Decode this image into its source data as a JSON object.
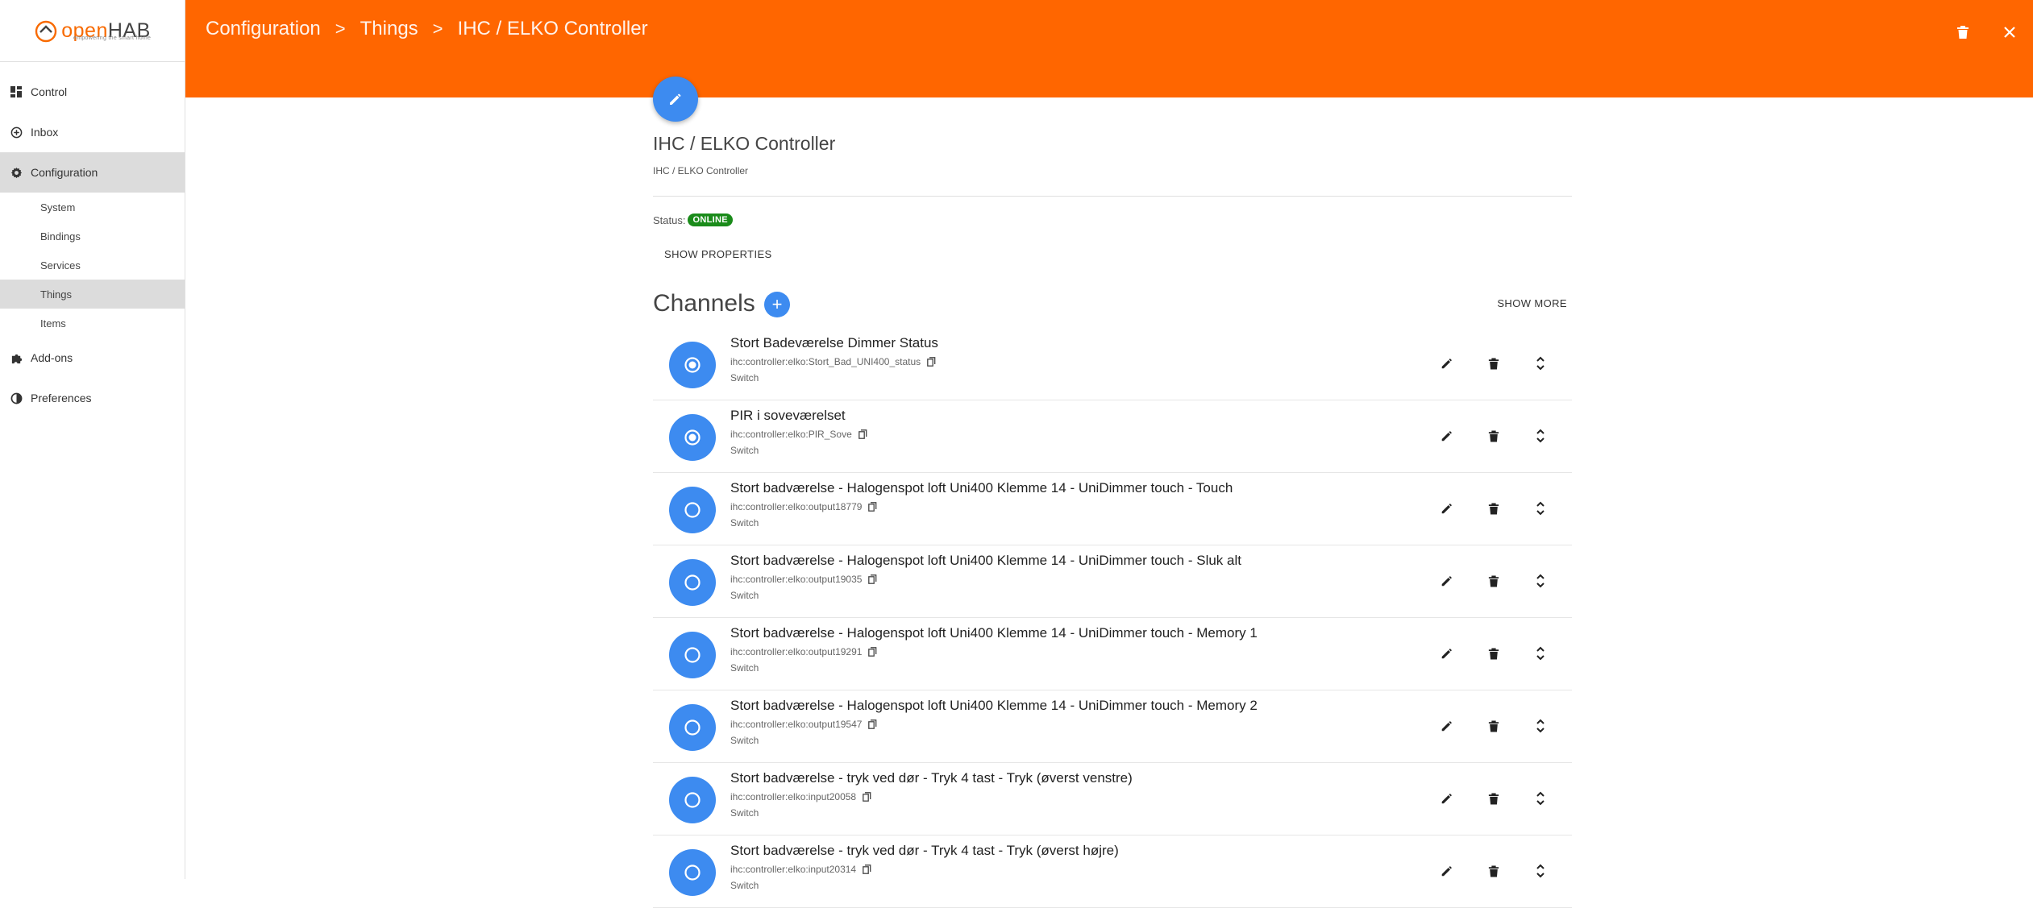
{
  "app": {
    "logo_prefix": "open",
    "logo_suffix": "HAB",
    "logo_tagline": "empowering the smart home"
  },
  "sidebar": {
    "items": [
      {
        "label": "Control",
        "icon": "dashboard-icon"
      },
      {
        "label": "Inbox",
        "icon": "inbox-icon"
      },
      {
        "label": "Configuration",
        "icon": "gear-icon"
      },
      {
        "label": "Add-ons",
        "icon": "puzzle-icon"
      },
      {
        "label": "Preferences",
        "icon": "contrast-icon"
      }
    ],
    "config_sub": [
      "System",
      "Bindings",
      "Services",
      "Things",
      "Items"
    ]
  },
  "header": {
    "crumbs": [
      "Configuration",
      "Things",
      "IHC / ELKO Controller"
    ],
    "separator": ">"
  },
  "thing": {
    "title": "IHC / ELKO Controller",
    "subtitle": "IHC / ELKO Controller",
    "status_label": "Status:",
    "status_value": "ONLINE",
    "status_color": "#1a8b1a",
    "show_properties": "SHOW PROPERTIES"
  },
  "channels": {
    "title": "Channels",
    "add_label": "+",
    "show_more": "SHOW MORE",
    "items": [
      {
        "title": "Stort Badeværelse Dimmer Status",
        "uid": "ihc:controller:elko:Stort_Bad_UNI400_status",
        "type": "Switch",
        "state": "on"
      },
      {
        "title": "PIR i soveværelset",
        "uid": "ihc:controller:elko:PIR_Sove",
        "type": "Switch",
        "state": "on"
      },
      {
        "title": "Stort badværelse - Halogenspot loft Uni400 Klemme 14 - UniDimmer touch - Touch",
        "uid": "ihc:controller:elko:output18779",
        "type": "Switch",
        "state": "off"
      },
      {
        "title": "Stort badværelse - Halogenspot loft Uni400 Klemme 14 - UniDimmer touch - Sluk alt",
        "uid": "ihc:controller:elko:output19035",
        "type": "Switch",
        "state": "off"
      },
      {
        "title": "Stort badværelse - Halogenspot loft Uni400 Klemme 14 - UniDimmer touch - Memory 1",
        "uid": "ihc:controller:elko:output19291",
        "type": "Switch",
        "state": "off"
      },
      {
        "title": "Stort badværelse - Halogenspot loft Uni400 Klemme 14 - UniDimmer touch - Memory 2",
        "uid": "ihc:controller:elko:output19547",
        "type": "Switch",
        "state": "off"
      },
      {
        "title": "Stort badværelse - tryk ved dør - Tryk 4 tast - Tryk (øverst venstre)",
        "uid": "ihc:controller:elko:input20058",
        "type": "Switch",
        "state": "off"
      },
      {
        "title": "Stort badværelse - tryk ved dør - Tryk 4 tast - Tryk (øverst højre)",
        "uid": "ihc:controller:elko:input20314",
        "type": "Switch",
        "state": "off"
      }
    ]
  },
  "colors": {
    "header": "#ff6600",
    "accent": "#3d8bf0",
    "active_nav": "#dcdcdc"
  }
}
